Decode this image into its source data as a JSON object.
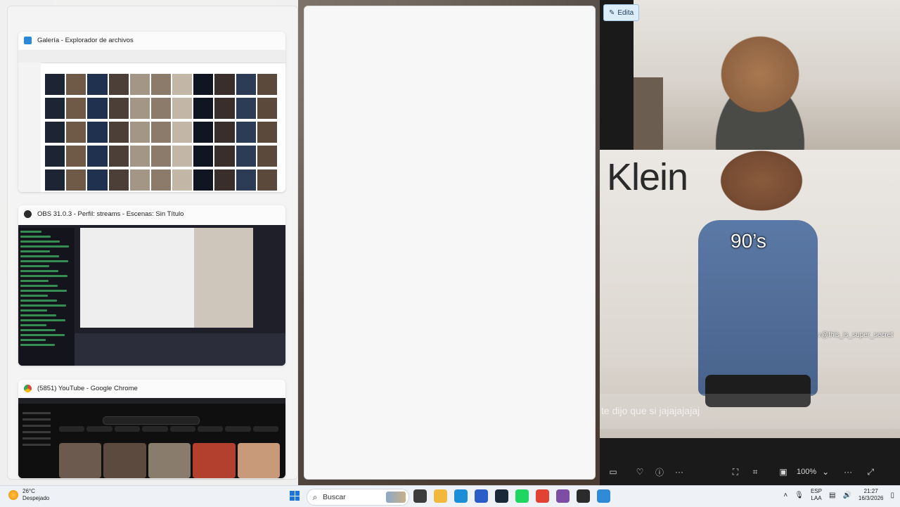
{
  "snap_assist": {
    "windows": [
      {
        "title": "Galería - Explorador de archivos",
        "icon": "gallery-icon",
        "color": "#2b88d8"
      },
      {
        "title": "OBS 31.0.3 - Perfil: streams - Escenas: Sin Título",
        "icon": "obs-icon",
        "color": "#2b2b2b"
      },
      {
        "title": "(5851) YouTube - Google Chrome",
        "icon": "chrome-icon",
        "color": "#e9453c"
      }
    ]
  },
  "video_panel": {
    "edit_label": "Edita",
    "meme_brand": "Klein",
    "meme_overlay": "90’s",
    "meme_handle": "@this_is_super_secret",
    "caption": "te dijo que si jajajajajaj",
    "zoom": "100%"
  },
  "taskbar": {
    "weather_temp": "26°C",
    "weather_desc": "Despejado",
    "search_placeholder": "Buscar",
    "lang_top": "ESP",
    "lang_bottom": "LAA",
    "time": "21:27",
    "date": "16/3/2026",
    "pinned": [
      {
        "name": "task-view-icon",
        "color": "#3c3c3c"
      },
      {
        "name": "file-explorer-icon",
        "color": "#f2b83b"
      },
      {
        "name": "edge-icon",
        "color": "#1c8ed8"
      },
      {
        "name": "store-icon",
        "color": "#2a5dc8"
      },
      {
        "name": "steam-icon",
        "color": "#1b2838"
      },
      {
        "name": "spotify-icon",
        "color": "#1ed760"
      },
      {
        "name": "chrome-icon",
        "color": "#e34133"
      },
      {
        "name": "winrar-icon",
        "color": "#7d4ea3"
      },
      {
        "name": "obs-icon",
        "color": "#2b2b2b"
      },
      {
        "name": "photos-icon",
        "color": "#2f8ad8"
      }
    ]
  }
}
